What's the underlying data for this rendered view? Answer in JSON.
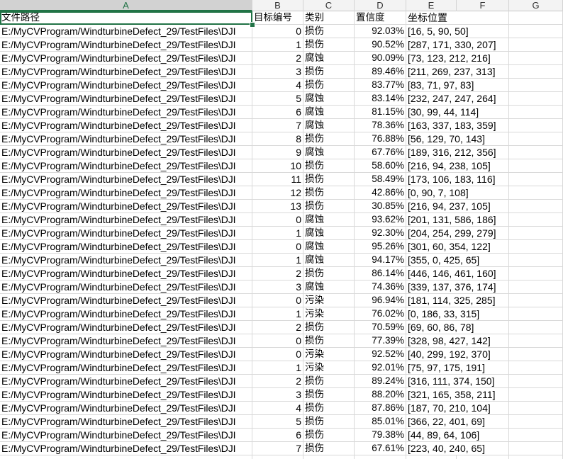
{
  "columns": [
    "A",
    "B",
    "C",
    "D",
    "E",
    "F",
    "G"
  ],
  "header_row": {
    "path": "文件路径",
    "id": "目标编号",
    "category": "类别",
    "confidence": "置信度",
    "coords": "坐标位置"
  },
  "rows": [
    {
      "path": "E:/MyCVProgram/WindturbineDefect_29/TestFiles\\DJI",
      "id": "0",
      "category": "损伤",
      "confidence": "92.03%",
      "coords": "[16, 5, 90, 50]"
    },
    {
      "path": "E:/MyCVProgram/WindturbineDefect_29/TestFiles\\DJI",
      "id": "1",
      "category": "损伤",
      "confidence": "90.52%",
      "coords": "[287, 171, 330, 207]"
    },
    {
      "path": "E:/MyCVProgram/WindturbineDefect_29/TestFiles\\DJI",
      "id": "2",
      "category": "腐蚀",
      "confidence": "90.09%",
      "coords": "[73, 123, 212, 216]"
    },
    {
      "path": "E:/MyCVProgram/WindturbineDefect_29/TestFiles\\DJI",
      "id": "3",
      "category": "损伤",
      "confidence": "89.46%",
      "coords": "[211, 269, 237, 313]"
    },
    {
      "path": "E:/MyCVProgram/WindturbineDefect_29/TestFiles\\DJI",
      "id": "4",
      "category": "损伤",
      "confidence": "83.77%",
      "coords": "[83, 71, 97, 83]"
    },
    {
      "path": "E:/MyCVProgram/WindturbineDefect_29/TestFiles\\DJI",
      "id": "5",
      "category": "腐蚀",
      "confidence": "83.14%",
      "coords": "[232, 247, 247, 264]"
    },
    {
      "path": "E:/MyCVProgram/WindturbineDefect_29/TestFiles\\DJI",
      "id": "6",
      "category": "腐蚀",
      "confidence": "81.15%",
      "coords": "[30, 99, 44, 114]"
    },
    {
      "path": "E:/MyCVProgram/WindturbineDefect_29/TestFiles\\DJI",
      "id": "7",
      "category": "腐蚀",
      "confidence": "78.36%",
      "coords": "[163, 337, 183, 359]"
    },
    {
      "path": "E:/MyCVProgram/WindturbineDefect_29/TestFiles\\DJI",
      "id": "8",
      "category": "损伤",
      "confidence": "76.88%",
      "coords": "[56, 129, 70, 143]"
    },
    {
      "path": "E:/MyCVProgram/WindturbineDefect_29/TestFiles\\DJI",
      "id": "9",
      "category": "腐蚀",
      "confidence": "67.76%",
      "coords": "[189, 316, 212, 356]"
    },
    {
      "path": "E:/MyCVProgram/WindturbineDefect_29/TestFiles\\DJI",
      "id": "10",
      "category": "损伤",
      "confidence": "58.60%",
      "coords": "[216, 94, 238, 105]"
    },
    {
      "path": "E:/MyCVProgram/WindturbineDefect_29/TestFiles\\DJI",
      "id": "11",
      "category": "损伤",
      "confidence": "58.49%",
      "coords": "[173, 106, 183, 116]"
    },
    {
      "path": "E:/MyCVProgram/WindturbineDefect_29/TestFiles\\DJI",
      "id": "12",
      "category": "损伤",
      "confidence": "42.86%",
      "coords": "[0, 90, 7, 108]"
    },
    {
      "path": "E:/MyCVProgram/WindturbineDefect_29/TestFiles\\DJI",
      "id": "13",
      "category": "损伤",
      "confidence": "30.85%",
      "coords": "[216, 94, 237, 105]"
    },
    {
      "path": "E:/MyCVProgram/WindturbineDefect_29/TestFiles\\DJI",
      "id": "0",
      "category": "腐蚀",
      "confidence": "93.62%",
      "coords": "[201, 131, 586, 186]"
    },
    {
      "path": "E:/MyCVProgram/WindturbineDefect_29/TestFiles\\DJI",
      "id": "1",
      "category": "腐蚀",
      "confidence": "92.30%",
      "coords": "[204, 254, 299, 279]"
    },
    {
      "path": "E:/MyCVProgram/WindturbineDefect_29/TestFiles\\DJI",
      "id": "0",
      "category": "腐蚀",
      "confidence": "95.26%",
      "coords": "[301, 60, 354, 122]"
    },
    {
      "path": "E:/MyCVProgram/WindturbineDefect_29/TestFiles\\DJI",
      "id": "1",
      "category": "腐蚀",
      "confidence": "94.17%",
      "coords": "[355, 0, 425, 65]"
    },
    {
      "path": "E:/MyCVProgram/WindturbineDefect_29/TestFiles\\DJI",
      "id": "2",
      "category": "损伤",
      "confidence": "86.14%",
      "coords": "[446, 146, 461, 160]"
    },
    {
      "path": "E:/MyCVProgram/WindturbineDefect_29/TestFiles\\DJI",
      "id": "3",
      "category": "腐蚀",
      "confidence": "74.36%",
      "coords": "[339, 137, 376, 174]"
    },
    {
      "path": "E:/MyCVProgram/WindturbineDefect_29/TestFiles\\DJI",
      "id": "0",
      "category": "污染",
      "confidence": "96.94%",
      "coords": "[181, 114, 325, 285]"
    },
    {
      "path": "E:/MyCVProgram/WindturbineDefect_29/TestFiles\\DJI",
      "id": "1",
      "category": "污染",
      "confidence": "76.02%",
      "coords": "[0, 186, 33, 315]"
    },
    {
      "path": "E:/MyCVProgram/WindturbineDefect_29/TestFiles\\DJI",
      "id": "2",
      "category": "损伤",
      "confidence": "70.59%",
      "coords": "[69, 60, 86, 78]"
    },
    {
      "path": "E:/MyCVProgram/WindturbineDefect_29/TestFiles\\DJI",
      "id": "0",
      "category": "损伤",
      "confidence": "77.39%",
      "coords": "[328, 98, 427, 142]"
    },
    {
      "path": "E:/MyCVProgram/WindturbineDefect_29/TestFiles\\DJI",
      "id": "0",
      "category": "污染",
      "confidence": "92.52%",
      "coords": "[40, 299, 192, 370]"
    },
    {
      "path": "E:/MyCVProgram/WindturbineDefect_29/TestFiles\\DJI",
      "id": "1",
      "category": "污染",
      "confidence": "92.01%",
      "coords": "[75, 97, 175, 191]"
    },
    {
      "path": "E:/MyCVProgram/WindturbineDefect_29/TestFiles\\DJI",
      "id": "2",
      "category": "损伤",
      "confidence": "89.24%",
      "coords": "[316, 111, 374, 150]"
    },
    {
      "path": "E:/MyCVProgram/WindturbineDefect_29/TestFiles\\DJI",
      "id": "3",
      "category": "损伤",
      "confidence": "88.20%",
      "coords": "[321, 165, 358, 211]"
    },
    {
      "path": "E:/MyCVProgram/WindturbineDefect_29/TestFiles\\DJI",
      "id": "4",
      "category": "损伤",
      "confidence": "87.86%",
      "coords": "[187, 70, 210, 104]"
    },
    {
      "path": "E:/MyCVProgram/WindturbineDefect_29/TestFiles\\DJI",
      "id": "5",
      "category": "损伤",
      "confidence": "85.01%",
      "coords": "[366, 22, 401, 69]"
    },
    {
      "path": "E:/MyCVProgram/WindturbineDefect_29/TestFiles\\DJI",
      "id": "6",
      "category": "损伤",
      "confidence": "79.38%",
      "coords": "[44, 89, 64, 106]"
    },
    {
      "path": "E:/MyCVProgram/WindturbineDefect_29/TestFiles\\DJI",
      "id": "7",
      "category": "损伤",
      "confidence": "67.61%",
      "coords": "[223, 40, 240, 65]"
    }
  ],
  "colors": {
    "accent": "#217346",
    "header_bg": "#f3f3f3",
    "gridline": "#d9d9d9"
  }
}
